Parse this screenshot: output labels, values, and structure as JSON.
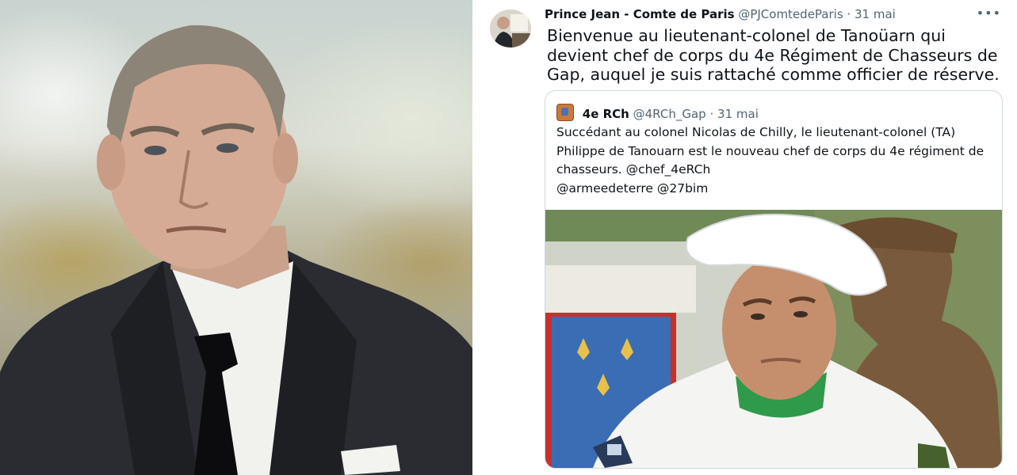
{
  "tweet": {
    "author_name": "Prince Jean - Comte de Paris",
    "author_handle": "@PJComtedeParis",
    "separator": "·",
    "date": "31 mai",
    "more_icon": "more-horizontal-icon",
    "more_label": "•••",
    "text_lines": [
      "Bienvenue au lieutenant-colonel de Tanoüarn qui",
      "devient chef de corps du 4e Régiment de Chasseurs de",
      "Gap, auquel je suis rattaché comme officier de réserve."
    ]
  },
  "quote": {
    "author_name": "4e RCh",
    "author_handle": "@4RCh_Gap",
    "separator": "·",
    "date": "31 mai",
    "text_lines": [
      "Succédant au colonel Nicolas de Chilly, le lieutenant-colonel (TA)",
      "Philippe de Tanouarn est le nouveau chef de corps du 4e régiment de",
      "chasseurs. @chef_4eRCh",
      "@armeedeterre @27bim"
    ]
  },
  "colors": {
    "text_primary": "#0f1419",
    "text_secondary": "#536471",
    "border": "#cfd9de"
  }
}
